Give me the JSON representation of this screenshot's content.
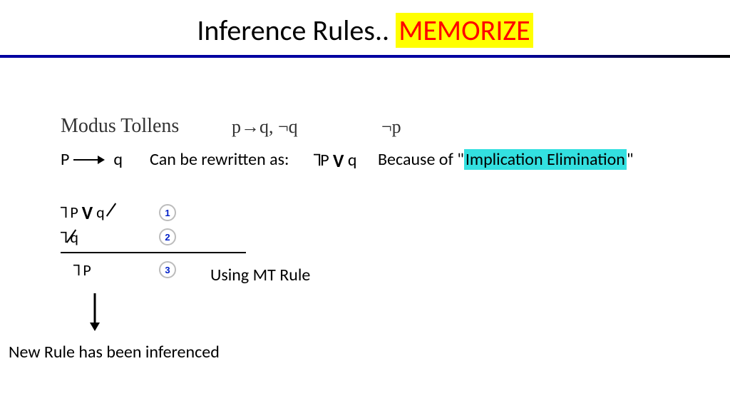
{
  "title": {
    "main": "Inference Rules.. ",
    "memorize": "MEMORIZE"
  },
  "rule_name": "Modus Tollens",
  "top_premises": "p→q, ¬q",
  "top_conclusion": "¬p",
  "implication": {
    "lhs": "P",
    "rhs": "q"
  },
  "rewrite_label": "Can be rewritten as:",
  "rewrite_expr_prefix": "˥P ",
  "rewrite_expr_vee": "V",
  "rewrite_expr_suffix": " q",
  "because_prefix": "Because of \"",
  "because_highlight": "Implication Elimination",
  "because_suffix": "\"",
  "proof": {
    "line1_prefix": "˥ P ",
    "line1_vee": "V",
    "line1_suffix": " q",
    "line2": "˥ q",
    "line3": "˥ P",
    "num1": "1",
    "num2": "2",
    "num3": "3"
  },
  "using_mt": "Using MT Rule",
  "inferenced": "New Rule has been inferenced"
}
